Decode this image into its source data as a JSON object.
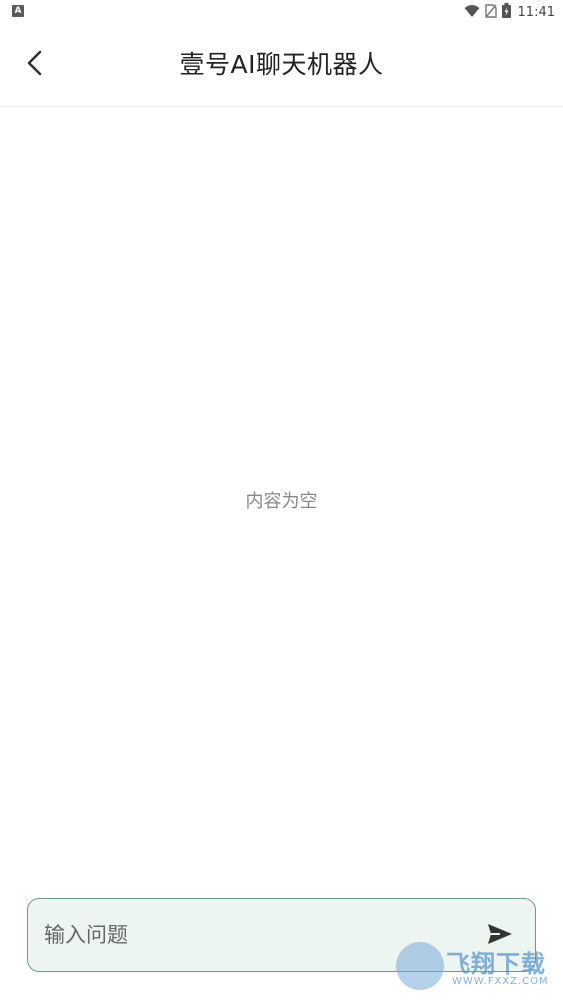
{
  "status_bar": {
    "time": "11:41",
    "left_icon": "a-notification-icon",
    "icons": [
      "wifi-icon",
      "no-sim-icon",
      "battery-charging-icon"
    ]
  },
  "header": {
    "title": "壹号AI聊天机器人",
    "back_icon": "chevron-left-icon"
  },
  "main": {
    "empty_text": "内容为空"
  },
  "composer": {
    "placeholder": "输入问题",
    "value": "",
    "send_icon": "send-icon"
  },
  "watermark": {
    "text": "飞翔下载",
    "sub": "WWW.FXXZ.COM"
  },
  "colors": {
    "input_border": "#6c9c86",
    "input_background": "#edf5f1",
    "title_text": "#222222",
    "empty_text": "#888888"
  }
}
